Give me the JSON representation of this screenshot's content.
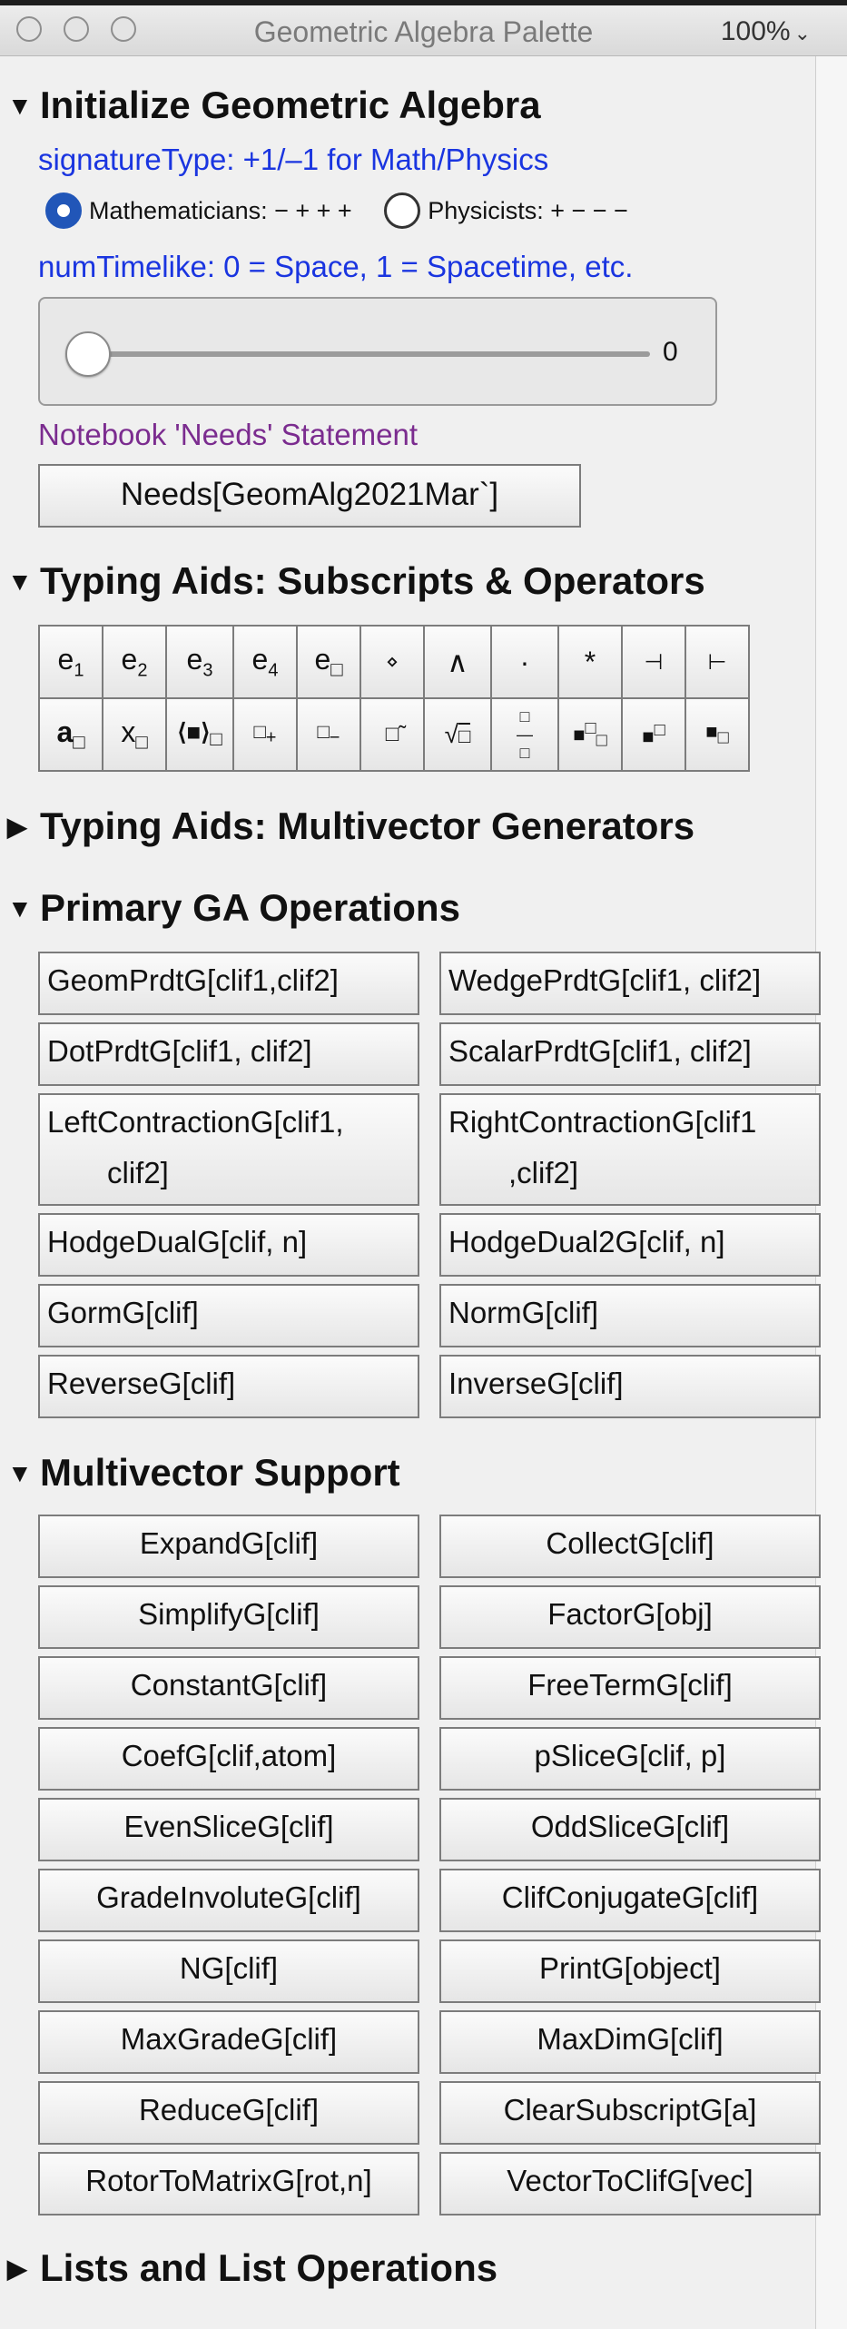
{
  "window": {
    "title": "Geometric Algebra Palette",
    "zoom": "100%"
  },
  "init": {
    "heading": "Initialize Geometric Algebra",
    "signature_label": "signatureType: +1/–1 for Math/Physics",
    "radio_math": "Mathematicians: − + + +",
    "radio_phys": "Physicists: + − − −",
    "numtimelike_label": "numTimelike: 0 = Space, 1 = Spacetime, etc.",
    "slider_value": "0",
    "needs_label": "Notebook 'Needs' Statement",
    "needs_button": "Needs[GeomAlg2021Mar`]"
  },
  "typing": {
    "heading": "Typing Aids: Subscripts & Operators",
    "row1": [
      "e1",
      "e2",
      "e3",
      "e4",
      "e□",
      "⋄",
      "∧",
      "·",
      "*",
      "⊣",
      "⊢"
    ],
    "row2": [
      "a□",
      "x□",
      "⟨■⟩□",
      "□+",
      "□−",
      "□̃",
      "√□",
      "□/□",
      "■□□",
      "■□",
      "■□"
    ]
  },
  "generators": {
    "heading": "Typing Aids: Multivector Generators"
  },
  "primary": {
    "heading": "Primary GA Operations",
    "left": [
      "GeomPrdtG[clif1,clif2]",
      "DotPrdtG[clif1, clif2]",
      "LeftContractionG[clif1,",
      "HodgeDualG[clif, n]",
      "GormG[clif]",
      "ReverseG[clif]"
    ],
    "left_cont": "clif2]",
    "right": [
      "WedgePrdtG[clif1, clif2]",
      "ScalarPrdtG[clif1, clif2]",
      "RightContractionG[clif1",
      "HodgeDual2G[clif, n]",
      "NormG[clif]",
      "InverseG[clif]"
    ],
    "right_cont": ",clif2]"
  },
  "support": {
    "heading": "Multivector Support",
    "left": [
      "ExpandG[clif]",
      "SimplifyG[clif]",
      "ConstantG[clif]",
      "CoefG[clif,atom]",
      "EvenSliceG[clif]",
      "GradeInvoluteG[clif]",
      "NG[clif]",
      "MaxGradeG[clif]",
      "ReduceG[clif]",
      "RotorToMatrixG[rot,n]"
    ],
    "right": [
      "CollectG[clif]",
      "FactorG[obj]",
      "FreeTermG[clif]",
      "pSliceG[clif, p]",
      "OddSliceG[clif]",
      "ClifConjugateG[clif]",
      "PrintG[object]",
      "MaxDimG[clif]",
      "ClearSubscriptG[a]",
      "VectorToClifG[vec]"
    ]
  },
  "lists": {
    "heading": "Lists and List Operations"
  }
}
